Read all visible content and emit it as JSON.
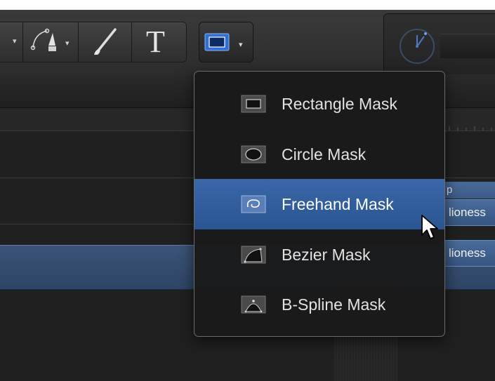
{
  "toolbar": {
    "tools": [
      {
        "name": "shape-tool-dropdown",
        "icon": "caret-down-icon"
      },
      {
        "name": "bezier-tool",
        "icon": "pen-tool-icon"
      },
      {
        "name": "paint-stroke-tool",
        "icon": "brush-icon"
      },
      {
        "name": "text-tool",
        "icon": "text-icon",
        "glyph": "T"
      }
    ],
    "mask_tool": {
      "icon": "rectangle-mask-icon",
      "active_color": "#2f6fd6"
    },
    "clock_icon": "clock-icon"
  },
  "menu": {
    "items": [
      {
        "label": "Rectangle Mask",
        "icon": "rectangle-mask-icon",
        "highlighted": false
      },
      {
        "label": "Circle Mask",
        "icon": "circle-mask-icon",
        "highlighted": false
      },
      {
        "label": "Freehand Mask",
        "icon": "freehand-mask-icon",
        "highlighted": true
      },
      {
        "label": "Bezier Mask",
        "icon": "bezier-mask-icon",
        "highlighted": false
      },
      {
        "label": "B-Spline Mask",
        "icon": "bspline-mask-icon",
        "highlighted": false
      }
    ],
    "highlight_color": "#2f5c9c"
  },
  "layers": {
    "header_label": "p",
    "items": [
      "lioness",
      "lioness"
    ]
  }
}
